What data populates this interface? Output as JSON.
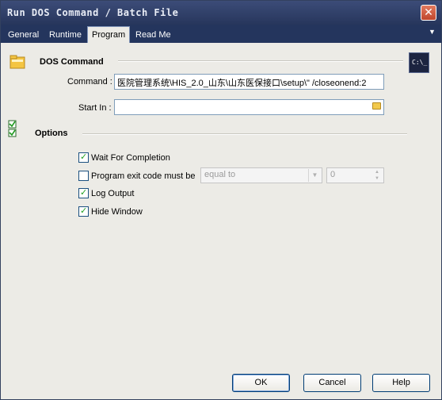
{
  "window": {
    "title": "Run DOS Command / Batch File",
    "close_glyph": "✕"
  },
  "tabs": [
    {
      "label": "General"
    },
    {
      "label": "Runtime"
    },
    {
      "label": "Program"
    },
    {
      "label": "Read Me"
    }
  ],
  "tab_menu_glyph": "▼",
  "dos_section": {
    "title": "DOS Command",
    "badge": "C:\\_",
    "command_label": "Command :",
    "command_value": "医院管理系统\\HIS_2.0_山东\\山东医保接口\\setup\\\" /closeonend:2",
    "start_in_label": "Start In :",
    "start_in_value": ""
  },
  "options_section": {
    "title": "Options",
    "wait_label": "Wait For Completion",
    "wait_checked": true,
    "exit_label": "Program exit code must be",
    "exit_checked": false,
    "exit_compare": "equal to",
    "exit_value": "0",
    "log_label": "Log Output",
    "log_checked": true,
    "hide_label": "Hide Window",
    "hide_checked": true
  },
  "buttons": {
    "ok": "OK",
    "cancel": "Cancel",
    "help": "Help"
  },
  "colors": {
    "titlebar": "#27365c",
    "panel": "#ecebe6",
    "accent": "#7f9db9"
  }
}
